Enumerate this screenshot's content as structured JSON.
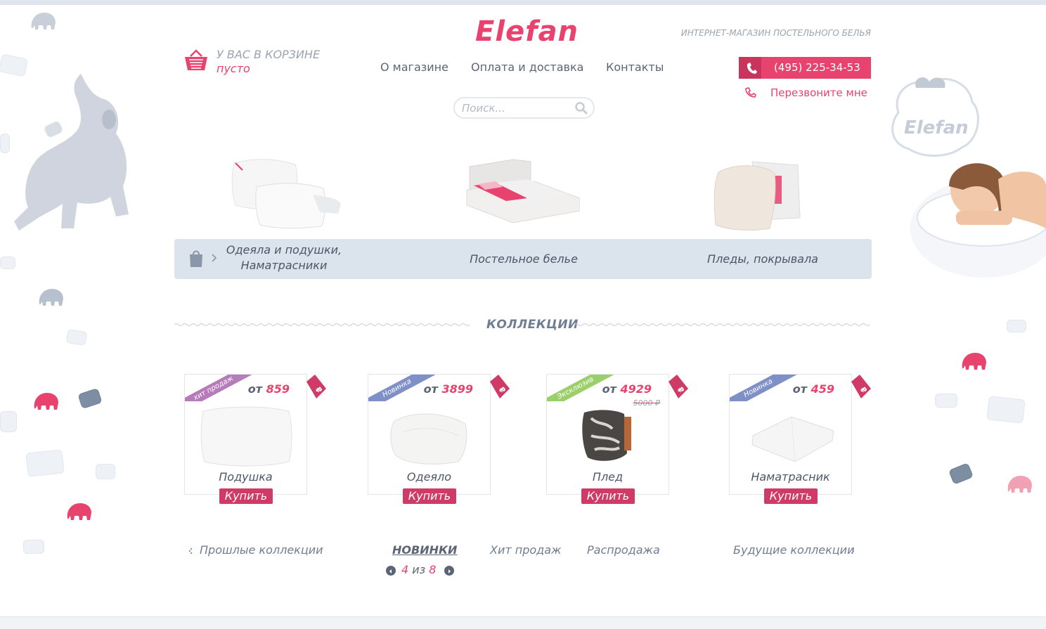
{
  "header": {
    "logo": "Elefan",
    "tagline": "ИНТЕРНЕТ-МАГАЗИН ПОСТЕЛЬНОГО БЕЛЬЯ",
    "cart_title": "У ВАС В КОРЗИНЕ",
    "cart_status": "пусто",
    "nav": [
      "О магазине",
      "Оплата и доставка",
      "Контакты"
    ],
    "phone": "(495) 225-34-53",
    "callback": "Перезвоните мне",
    "search_placeholder": "Поиск...",
    "cloud_logo": "Elefan"
  },
  "categories": [
    {
      "label_line1": "Одеяла и подушки,",
      "label_line2": "Наматрасники"
    },
    {
      "label_line1": "Постельное белье",
      "label_line2": ""
    },
    {
      "label_line1": "Пледы, покрывала",
      "label_line2": ""
    }
  ],
  "collections": {
    "title": "КОЛЛЕКЦИИ",
    "products": [
      {
        "badge": "хит продаж",
        "badge_color": "#b67bb9",
        "price_prefix": "от",
        "price": "859",
        "old_price": "",
        "name": "Подушка",
        "buy": "Купить"
      },
      {
        "badge": "Новинка",
        "badge_color": "#7f8fc8",
        "price_prefix": "от",
        "price": "3899",
        "old_price": "",
        "name": "Одеяло",
        "buy": "Купить"
      },
      {
        "badge": "Эксклюзив",
        "badge_color": "#9bcf6a",
        "price_prefix": "от",
        "price": "4929",
        "old_price": "5000 ₽",
        "name": "Плед",
        "buy": "Купить"
      },
      {
        "badge": "Новинка",
        "badge_color": "#7f8fc8",
        "price_prefix": "от",
        "price": "459",
        "old_price": "",
        "name": "Наматрасник",
        "buy": "Купить"
      }
    ],
    "tag_symbol": "₽",
    "past": "Прошлые коллекции",
    "tabs": [
      "НОВИНКИ",
      "Хит продаж",
      "Распродажа"
    ],
    "future": "Будущие коллекции",
    "pager_current": "4",
    "pager_sep": "из",
    "pager_total": "8"
  },
  "colors": {
    "accent": "#e8426e",
    "text": "#5b6577",
    "bar": "#dbe3ec"
  }
}
